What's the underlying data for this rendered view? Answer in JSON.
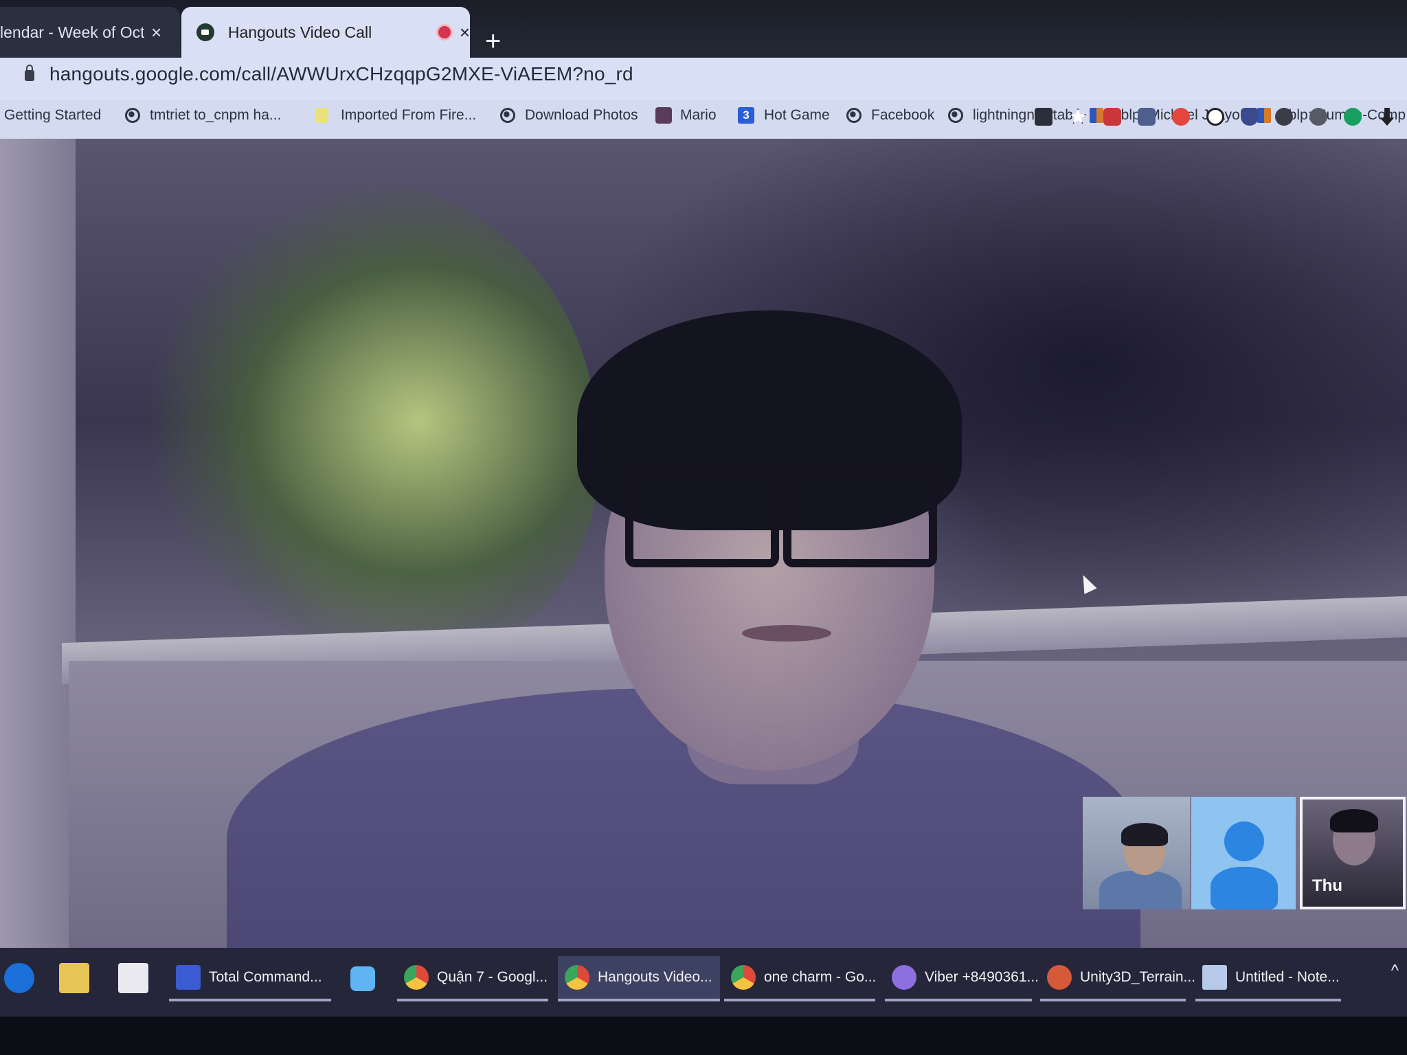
{
  "tabs": [
    {
      "label": "lendar - Week of Octol",
      "active": false
    },
    {
      "label": "Hangouts Video Call",
      "active": true
    }
  ],
  "new_tab_symbol": "+",
  "close_symbol": "×",
  "address_bar": {
    "url": "hangouts.google.com/call/AWWUrxCHzqqpG2MXE-ViAEEM?no_rd"
  },
  "bookmarks": [
    {
      "label": "Getting Started",
      "icon": "none"
    },
    {
      "label": "tmtriet to_cnpm ha...",
      "icon": "globe-icon"
    },
    {
      "label": "Imported From Fire...",
      "icon": "folder-icon"
    },
    {
      "label": "Download Photos",
      "icon": "globe-icon"
    },
    {
      "label": "Mario",
      "icon": "mario-icon"
    },
    {
      "label": "Hot Game",
      "icon": "number-3-icon"
    },
    {
      "label": "Facebook",
      "icon": "globe-icon"
    },
    {
      "label": "lightningnewtab",
      "icon": "globe-icon"
    },
    {
      "label": "dblp: Michael J. Lyo...",
      "icon": "dblp-icon"
    },
    {
      "label": "dblp: Human-Comp...",
      "icon": "dblp-icon"
    }
  ],
  "extensions": [
    "camera-icon",
    "star-icon",
    "extension-red-icon",
    "extension-camera-icon",
    "extension-flash-icon",
    "play-icon",
    "shield-icon",
    "extension-dark-icon",
    "extension-circle-icon",
    "grammarly-icon",
    "download-icon"
  ],
  "thumbnails": [
    {
      "name": "",
      "kind": "video"
    },
    {
      "name": "",
      "kind": "avatar"
    },
    {
      "name": "Thu",
      "kind": "video"
    }
  ],
  "taskbar": {
    "pinned": [
      "edge-icon",
      "file-explorer-icon",
      "store-icon"
    ],
    "items": [
      {
        "label": "Total Command...",
        "icon": "floppy-icon"
      },
      {
        "label": "",
        "icon": "zoom-icon"
      },
      {
        "label": "Quận 7 - Googl...",
        "icon": "chrome-icon"
      },
      {
        "label": "Hangouts Video...",
        "icon": "chrome-icon",
        "active": true
      },
      {
        "label": "one charm - Go...",
        "icon": "chrome-icon"
      },
      {
        "label": "Viber +8490361...",
        "icon": "viber-icon"
      },
      {
        "label": "Unity3D_Terrain...",
        "icon": "powerpoint-icon"
      },
      {
        "label": "Untitled - Note...",
        "icon": "notepad-icon"
      }
    ],
    "tray_chevron": "^"
  }
}
